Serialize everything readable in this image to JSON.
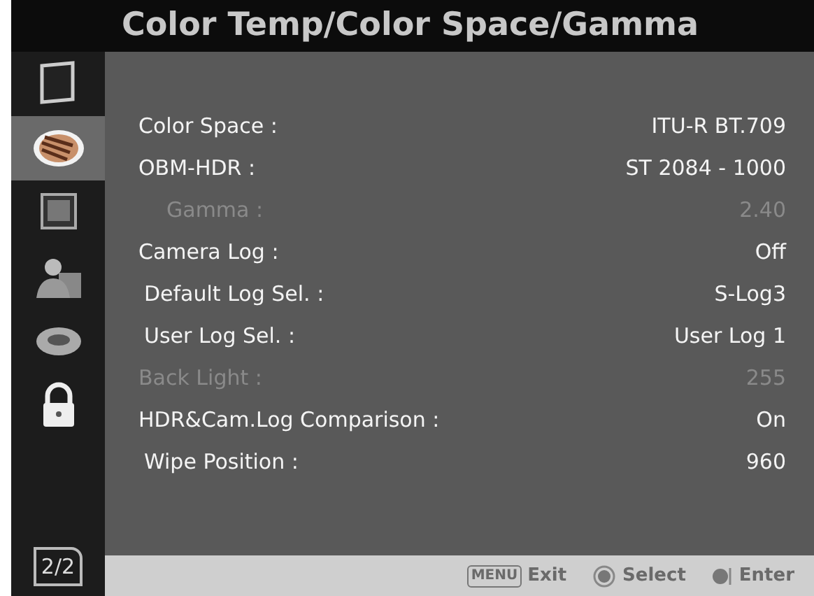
{
  "title": "Color Temp/Color Space/Gamma",
  "sidebar": {
    "items": [
      {
        "kind": "monitor",
        "selected": false
      },
      {
        "kind": "palette",
        "selected": true
      },
      {
        "kind": "screen",
        "selected": false
      },
      {
        "kind": "person",
        "selected": false
      },
      {
        "kind": "ring",
        "selected": false
      },
      {
        "kind": "lock",
        "selected": false
      }
    ],
    "page": "2/2"
  },
  "settings": [
    {
      "label": "Color Space :",
      "value": "ITU-R BT.709",
      "disabled": false
    },
    {
      "label": "OBM-HDR :",
      "value": "ST 2084 - 1000",
      "disabled": false,
      "children": [
        {
          "label": "Gamma :",
          "value": "2.40",
          "disabled": true
        }
      ]
    },
    {
      "label": "Camera Log :",
      "value": "Off",
      "disabled": false,
      "children": [
        {
          "label": "Default Log Sel. :",
          "value": "S-Log3",
          "disabled": false
        },
        {
          "label": "User Log Sel. :",
          "value": "User Log 1",
          "disabled": false
        }
      ]
    },
    {
      "label": "Back Light :",
      "value": "255",
      "disabled": true
    },
    {
      "label": "HDR&Cam.Log Comparison :",
      "value": "On",
      "disabled": false,
      "children": [
        {
          "label": "Wipe Position :",
          "value": "960",
          "disabled": false
        }
      ]
    }
  ],
  "footer": {
    "menu_key": "MENU",
    "exit": "Exit",
    "select": "Select",
    "enter": "Enter"
  }
}
